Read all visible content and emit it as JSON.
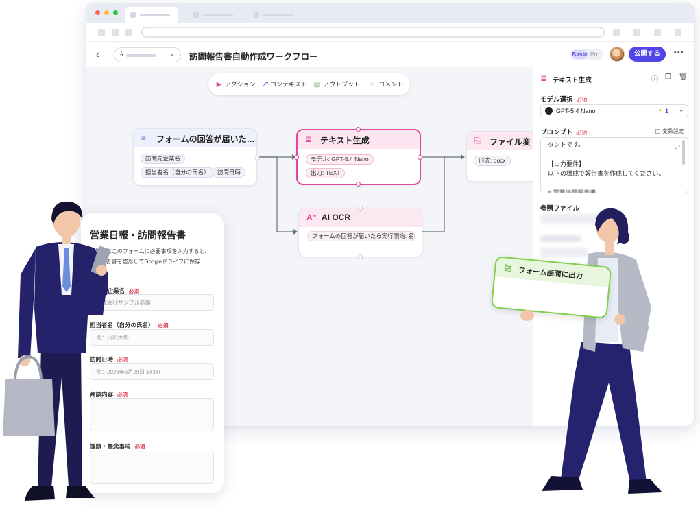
{
  "header": {
    "back_icon": "chevron-left-icon",
    "selector_prefix": "#",
    "title": "訪問報告書自動作成ワークフロー",
    "plan_basic": "Basic",
    "plan_pro": "Pro",
    "publish_label": "公開する",
    "more_label": "•••"
  },
  "toolbar": {
    "action": "アクション",
    "context": "コンテキスト",
    "output": "アウトプット",
    "comment": "コメント"
  },
  "nodes": {
    "trigger": {
      "title": "フォームの回答が届いた…",
      "chips": [
        "訪問先企業名",
        "担当者名（自分の氏名）",
        "訪問日時"
      ]
    },
    "textgen": {
      "title": "テキスト生成",
      "chips": [
        "モデル: GPT-5.4 Nano",
        "出力: TEXT"
      ]
    },
    "fileconv": {
      "title": "ファイル変",
      "chips": [
        "形式: docx"
      ]
    },
    "aiocr": {
      "title": "AI OCR",
      "chips": [
        "フォームの回答が届いたら実行開始: 名刺"
      ]
    }
  },
  "panel": {
    "title": "テキスト生成",
    "model_label": "モデル選択",
    "required": "必須",
    "model_value": "GPT-5.4 Nano",
    "model_badge": "1",
    "prompt_label": "プロンプト",
    "variable_settings": "変数設定",
    "prompt_lines": [
      "タントです。",
      "",
      "【出力要件】",
      "以下の構成で報告書を作成してください。",
      "",
      "# 営業訪問報告書"
    ],
    "reference_label": "参照ファイル"
  },
  "form": {
    "title": "営業日報・訪問報告書",
    "description": "訪問後にこのフォームに必要事項を入力すると、AIが報告書を整形してGoogleドライブに保存",
    "required": "必須",
    "fields": [
      {
        "label": "訪問先企業名",
        "placeholder": "株式会社サンプル商事"
      },
      {
        "label": "担当者名（自分の氏名）",
        "placeholder": "例：山田太郎"
      },
      {
        "label": "訪問日時",
        "placeholder": "例：2026年6月29日 14:00"
      },
      {
        "label": "商談内容",
        "placeholder": ""
      },
      {
        "label": "課題・懸念事項",
        "placeholder": ""
      }
    ]
  },
  "output_card": {
    "title": "フォーム画面に出力"
  },
  "colors": {
    "accent": "#4f46e5",
    "textgen_pink": "#e04a9b",
    "output_green": "#7ecf4c",
    "required_red": "#e0435b"
  }
}
